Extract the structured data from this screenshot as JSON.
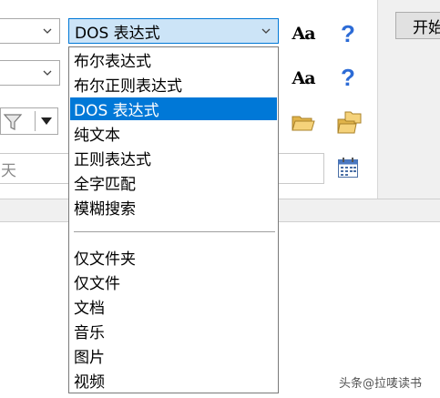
{
  "search": {
    "type_select_value": "DOS 表达式",
    "start_button_label": "开始",
    "date_placeholder": "天"
  },
  "dropdown": {
    "group1": [
      "布尔表达式",
      "布尔正则表达式",
      "DOS 表达式",
      "纯文本",
      "正则表达式",
      "全字匹配",
      "模糊搜索"
    ],
    "group2": [
      "仅文件夹",
      "仅文件",
      "文档",
      "音乐",
      "图片",
      "视频"
    ],
    "selected": "DOS 表达式"
  },
  "icons": {
    "match_case_1": "Aa",
    "help_1": "?",
    "match_case_2": "Aa",
    "help_2": "?"
  },
  "watermark": "头条@拉唛读书",
  "colors": {
    "selection": "#0078d7",
    "active_combo": "#cce4f7",
    "help_icon": "#2c6bd6"
  }
}
